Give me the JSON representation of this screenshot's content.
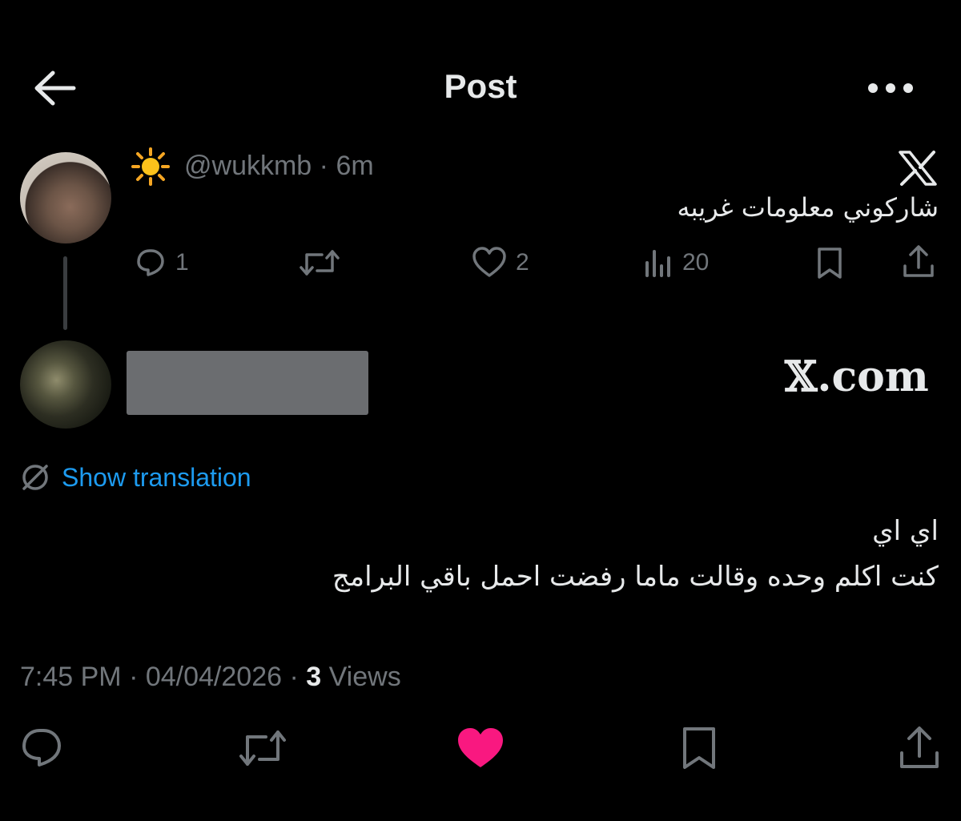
{
  "header": {
    "title": "Post",
    "back_icon": "arrow-left-icon",
    "more_icon": "more-horizontal-icon"
  },
  "parent_post": {
    "emoji": "☀️",
    "handle": "@wukkmb",
    "time": "6m",
    "text": "شاركوني معلومات غريبه",
    "logo": "x-logo-icon",
    "actions": {
      "reply_count": "1",
      "repost_count": "",
      "like_count": "2",
      "views_count": "20"
    }
  },
  "quoted_post": {
    "site": "𝕏.com"
  },
  "translation": {
    "label": "Show translation"
  },
  "reply": {
    "line1": "اي اي",
    "line2": "كنت اكلم وحده وقالت ماما رفضت احمل باقي البرامج"
  },
  "meta": {
    "time": "7:45 PM",
    "date": "04/04/2026",
    "views_count": "3",
    "views_label": "Views"
  },
  "colors": {
    "background": "#000000",
    "text": "#e7e9ea",
    "muted": "#71767b",
    "link": "#1d9bf0",
    "like_active": "#f91880"
  }
}
